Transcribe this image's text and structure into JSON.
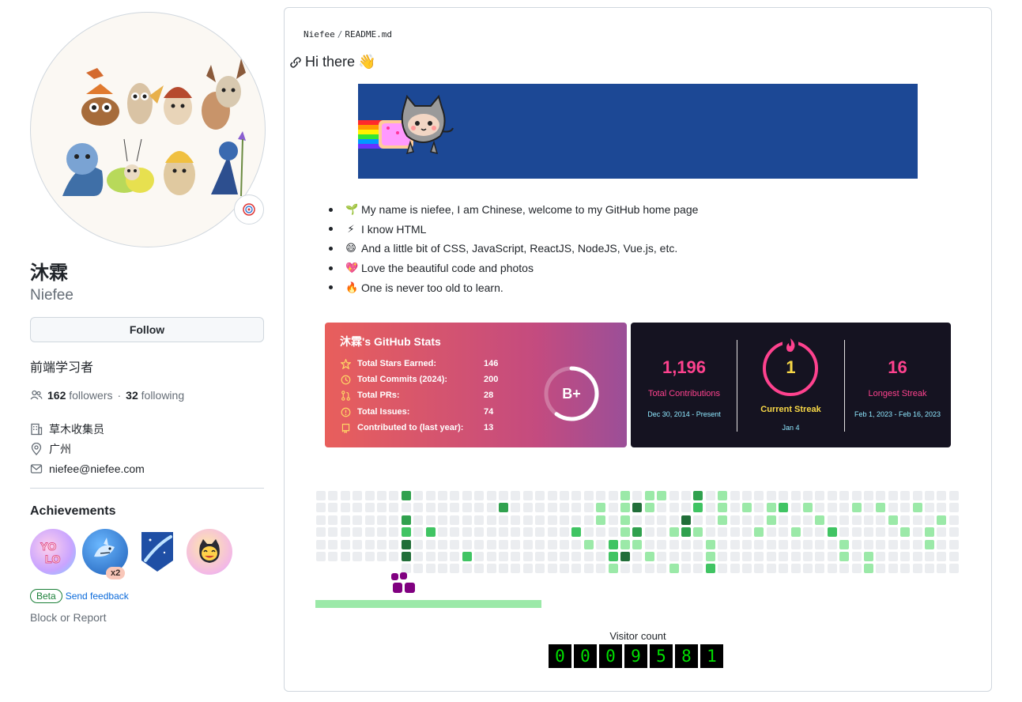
{
  "profile": {
    "name_cn": "沐霖",
    "username": "Niefee",
    "follow_label": "Follow",
    "bio": "前端学习者",
    "followers_count": "162",
    "followers_label": "followers",
    "sep": "·",
    "following_count": "32",
    "following_label": "following",
    "organization": "草木收集员",
    "location": "广州",
    "email": "niefee@niefee.com"
  },
  "achievements": {
    "title": "Achievements",
    "items": [
      {
        "name": "YOLO",
        "icon": "yolo-icon"
      },
      {
        "name": "Pull Shark",
        "icon": "shark-icon",
        "tier": "x2"
      },
      {
        "name": "Starstruck",
        "icon": "rocket-icon"
      },
      {
        "name": "Quickdraw",
        "icon": "cat-face-icon"
      }
    ],
    "beta_label": "Beta",
    "feedback_label": "Send feedback",
    "block_label": "Block or Report"
  },
  "readme": {
    "breadcrumb_user": "Niefee",
    "breadcrumb_sep": "/",
    "breadcrumb_file": "README.md",
    "heading": "Hi there",
    "heading_emoji": "👋",
    "bullets": [
      {
        "emoji": "🌱",
        "text": "My name is niefee, I am Chinese, welcome to my GitHub home page"
      },
      {
        "emoji": "⚡",
        "text": "I know HTML"
      },
      {
        "emoji": "😄",
        "text": "And a little bit of CSS, JavaScript, ReactJS, NodeJS, Vue.js, etc."
      },
      {
        "emoji": "💖",
        "text": "Love the beautiful code and photos"
      },
      {
        "emoji": "🔥",
        "text": "One is never too old to learn."
      }
    ]
  },
  "stats_card": {
    "title": "沐霖's GitHub Stats",
    "rank": "B+",
    "rank_fraction": 0.6,
    "rows": [
      {
        "icon": "star-icon",
        "label": "Total Stars Earned:",
        "value": "146"
      },
      {
        "icon": "clock-icon",
        "label": "Total Commits (2024):",
        "value": "200"
      },
      {
        "icon": "pr-icon",
        "label": "Total PRs:",
        "value": "28"
      },
      {
        "icon": "issue-icon",
        "label": "Total Issues:",
        "value": "74"
      },
      {
        "icon": "repo-icon",
        "label": "Contributed to (last year):",
        "value": "13"
      }
    ],
    "colors": {
      "start": "#e85f5c",
      "end": "#9b4f98",
      "icon": "#ffd666"
    }
  },
  "streak_card": {
    "total_contributions": "1,196",
    "total_label": "Total Contributions",
    "total_range": "Dec 30, 2014 - Present",
    "current_streak": "1",
    "current_label": "Current Streak",
    "current_range": "Jan 4",
    "longest_streak": "16",
    "longest_label": "Longest Streak",
    "longest_range": "Feb 1, 2023 - Feb 16, 2023",
    "colors": {
      "background": "#151321",
      "accent": "#fe428e",
      "current": "#f8d847"
    }
  },
  "contribution_grid": {
    "weeks": 53,
    "days": 7,
    "palette": [
      "#ebedf0",
      "#9be9a8",
      "#40c463",
      "#30a14e",
      "#216e39"
    ],
    "active_cells": [
      [
        7,
        0,
        3
      ],
      [
        7,
        1,
        0
      ],
      [
        7,
        2,
        3
      ],
      [
        7,
        3,
        2
      ],
      [
        7,
        4,
        4
      ],
      [
        7,
        5,
        4
      ],
      [
        9,
        3,
        2
      ],
      [
        12,
        5,
        2
      ],
      [
        15,
        1,
        3
      ],
      [
        21,
        3,
        2
      ],
      [
        22,
        4,
        1
      ],
      [
        23,
        1,
        1
      ],
      [
        23,
        2,
        1
      ],
      [
        24,
        4,
        2
      ],
      [
        24,
        5,
        2
      ],
      [
        24,
        6,
        1
      ],
      [
        25,
        0,
        1
      ],
      [
        25,
        1,
        1
      ],
      [
        25,
        2,
        1
      ],
      [
        25,
        3,
        1
      ],
      [
        25,
        4,
        1
      ],
      [
        25,
        5,
        4
      ],
      [
        26,
        1,
        4
      ],
      [
        26,
        3,
        3
      ],
      [
        26,
        4,
        1
      ],
      [
        27,
        0,
        1
      ],
      [
        27,
        1,
        1
      ],
      [
        27,
        5,
        1
      ],
      [
        28,
        0,
        1
      ],
      [
        29,
        3,
        1
      ],
      [
        29,
        6,
        1
      ],
      [
        30,
        2,
        4
      ],
      [
        30,
        3,
        3
      ],
      [
        31,
        0,
        3
      ],
      [
        31,
        1,
        2
      ],
      [
        31,
        3,
        1
      ],
      [
        32,
        4,
        1
      ],
      [
        32,
        5,
        1
      ],
      [
        32,
        6,
        2
      ],
      [
        33,
        0,
        1
      ],
      [
        33,
        1,
        1
      ],
      [
        33,
        2,
        1
      ],
      [
        35,
        1,
        1
      ],
      [
        36,
        3,
        1
      ],
      [
        37,
        1,
        1
      ],
      [
        37,
        2,
        1
      ],
      [
        38,
        1,
        2
      ],
      [
        39,
        3,
        1
      ],
      [
        40,
        1,
        1
      ],
      [
        41,
        2,
        1
      ],
      [
        42,
        3,
        2
      ],
      [
        43,
        4,
        1
      ],
      [
        43,
        5,
        1
      ],
      [
        44,
        1,
        1
      ],
      [
        45,
        5,
        1
      ],
      [
        45,
        6,
        1
      ],
      [
        46,
        1,
        1
      ],
      [
        47,
        2,
        1
      ],
      [
        48,
        3,
        1
      ],
      [
        49,
        1,
        1
      ],
      [
        50,
        3,
        1
      ],
      [
        50,
        4,
        1
      ],
      [
        51,
        2,
        1
      ]
    ],
    "progress": 0.35
  },
  "visitor": {
    "label": "Visitor count",
    "digits": [
      "0",
      "0",
      "0",
      "9",
      "5",
      "8",
      "1"
    ],
    "digit_color": "#00e000"
  }
}
